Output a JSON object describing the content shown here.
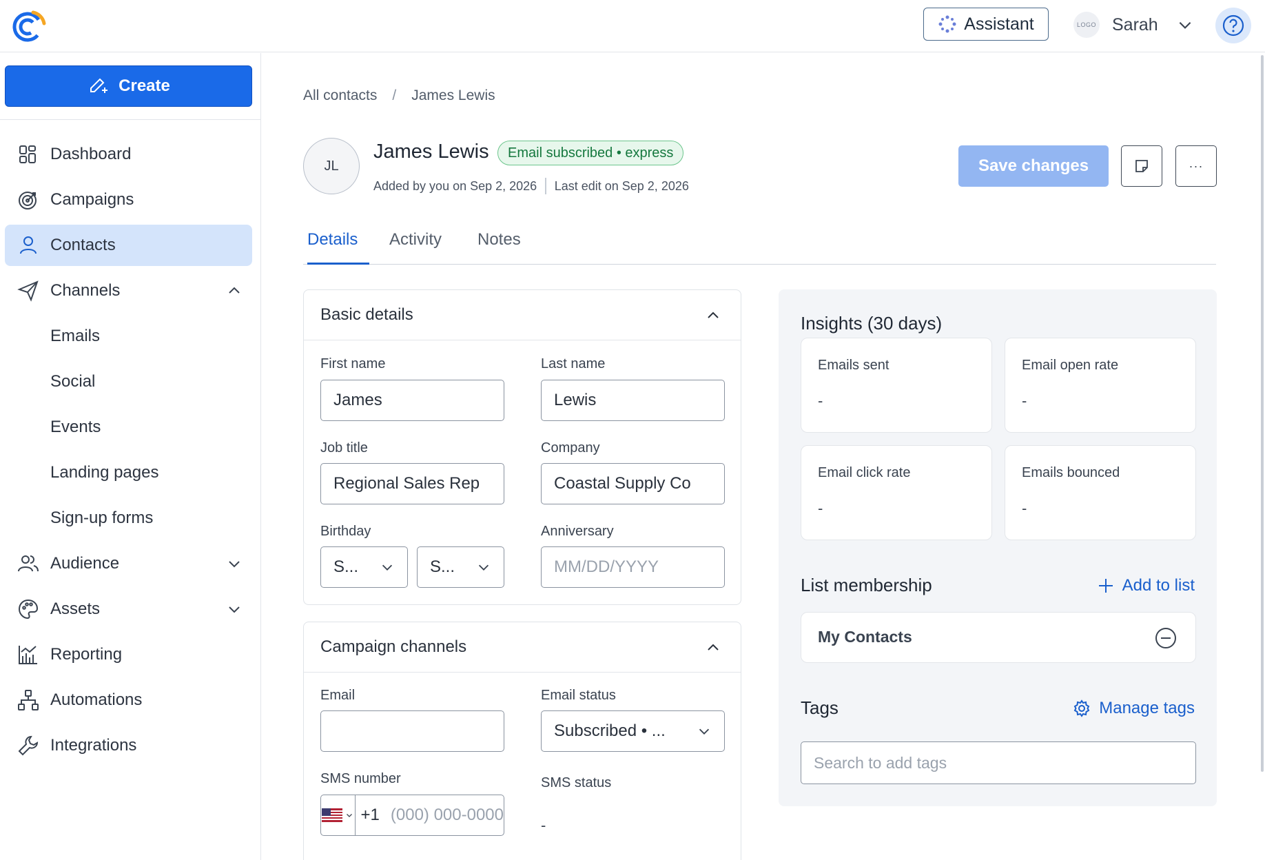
{
  "header": {
    "assistant_label": "Assistant",
    "user_logo_text": "LOGO",
    "user_name": "Sarah"
  },
  "sidebar": {
    "create_label": "Create",
    "items": [
      {
        "label": "Dashboard",
        "icon": "dashboard-icon"
      },
      {
        "label": "Campaigns",
        "icon": "target-icon"
      },
      {
        "label": "Contacts",
        "icon": "person-icon",
        "active": true
      },
      {
        "label": "Channels",
        "icon": "send-icon",
        "expanded": true
      },
      {
        "label": "Audience",
        "icon": "people-icon"
      },
      {
        "label": "Assets",
        "icon": "palette-icon"
      },
      {
        "label": "Reporting",
        "icon": "chart-icon"
      },
      {
        "label": "Automations",
        "icon": "flow-icon"
      },
      {
        "label": "Integrations",
        "icon": "wrench-icon"
      }
    ],
    "channel_subitems": [
      "Emails",
      "Social",
      "Events",
      "Landing pages",
      "Sign-up forms"
    ]
  },
  "breadcrumb": {
    "root": "All contacts",
    "sep": "/",
    "current": "James Lewis"
  },
  "contact": {
    "initials": "JL",
    "name": "James Lewis",
    "badge": "Email subscribed • express",
    "added": "Added by you on Sep 2, 2026",
    "last_edit": "Last edit on Sep 2, 2026"
  },
  "actions": {
    "save_label": "Save changes",
    "more_label": "···"
  },
  "tabs": [
    "Details",
    "Activity",
    "Notes"
  ],
  "basic_details": {
    "title": "Basic details",
    "first_name_label": "First name",
    "first_name": "James",
    "last_name_label": "Last name",
    "last_name": "Lewis",
    "job_title_label": "Job title",
    "job_title": "Regional Sales Rep",
    "company_label": "Company",
    "company": "Coastal Supply Co",
    "birthday_label": "Birthday",
    "birthday_month": "S...",
    "birthday_day": "S...",
    "anniversary_label": "Anniversary",
    "anniversary_placeholder": "MM/DD/YYYY"
  },
  "campaign_channels": {
    "title": "Campaign channels",
    "email_label": "Email",
    "email_value": "",
    "email_status_label": "Email status",
    "email_status": "Subscribed • ...",
    "sms_number_label": "SMS number",
    "sms_country_code": "+1",
    "sms_placeholder": "(000) 000-0000",
    "sms_status_label": "SMS status",
    "sms_status": "-"
  },
  "insights": {
    "title": "Insights (30 days)",
    "stats": [
      {
        "label": "Emails sent",
        "value": "-"
      },
      {
        "label": "Email open rate",
        "value": "-"
      },
      {
        "label": "Email click rate",
        "value": "-"
      },
      {
        "label": "Emails bounced",
        "value": "-"
      }
    ],
    "list_title": "List membership",
    "add_to_list": "Add to list",
    "lists": [
      "My Contacts"
    ],
    "tags_title": "Tags",
    "manage_tags": "Manage tags",
    "tags_placeholder": "Search to add tags"
  },
  "colors": {
    "brand_blue": "#1a6ae8",
    "link_blue": "#1a5fcc",
    "badge_green": "#15783e"
  }
}
